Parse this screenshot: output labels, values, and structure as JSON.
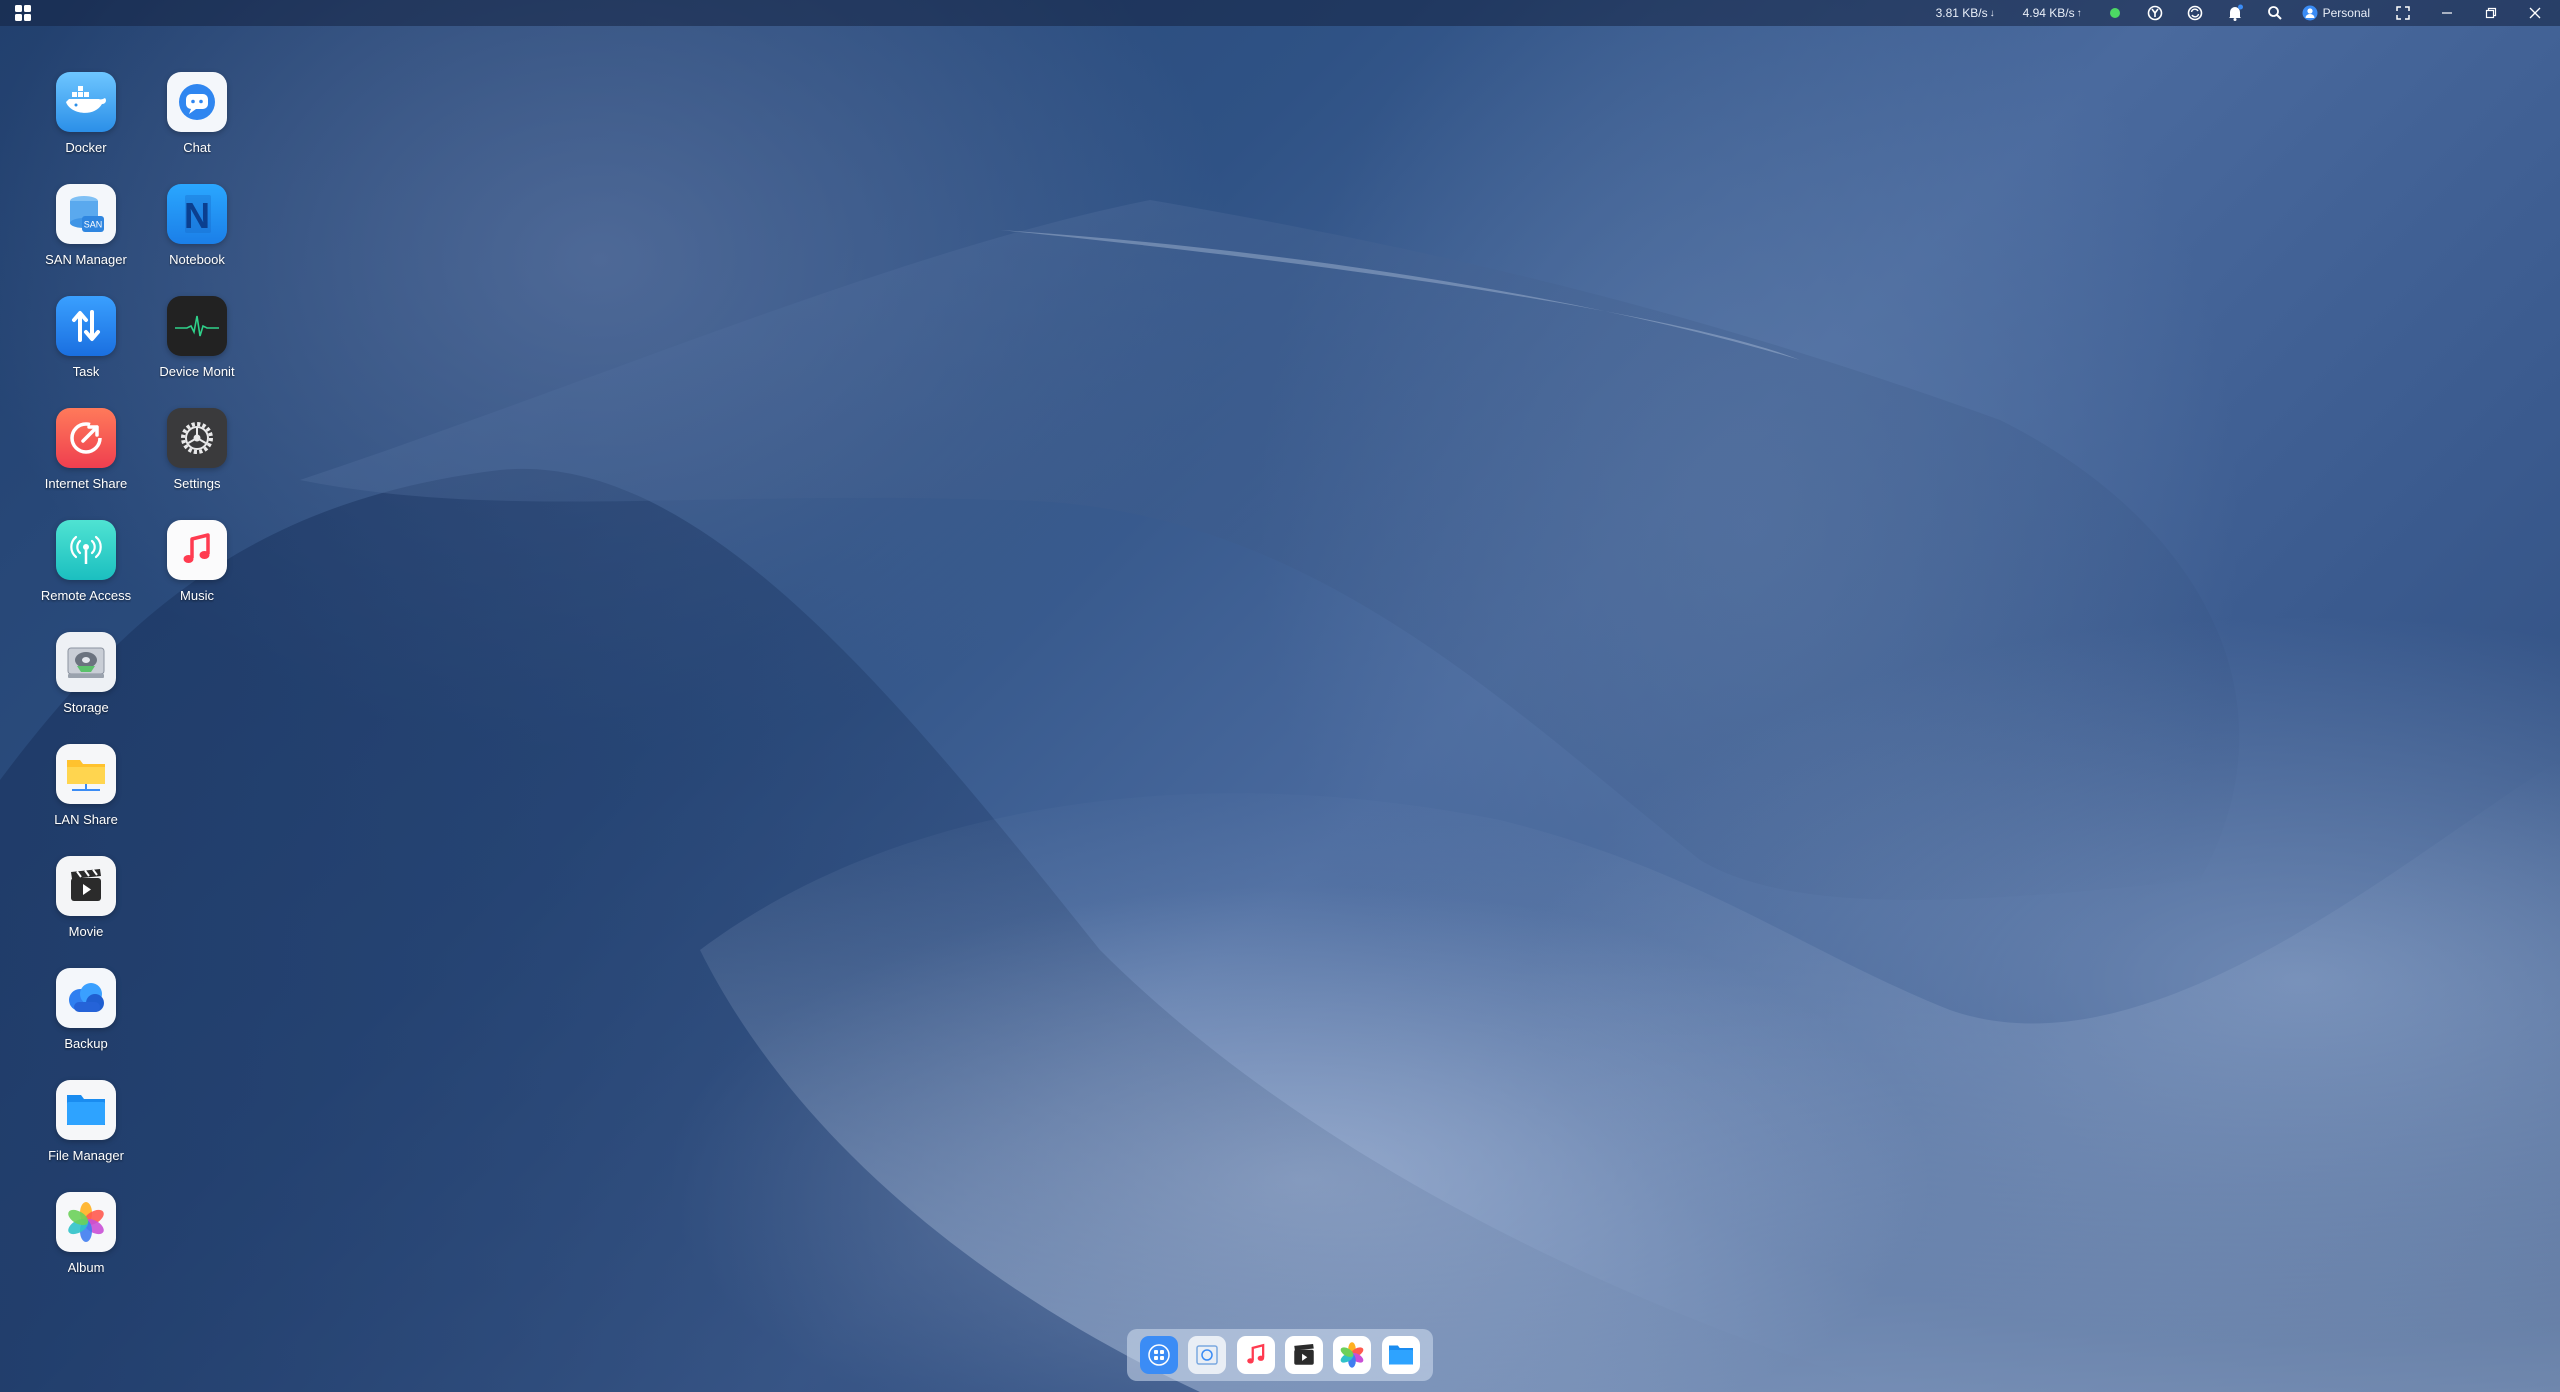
{
  "topbar": {
    "download_speed": "3.81 KB/s",
    "upload_speed": "4.94 KB/s",
    "user_label": "Personal",
    "status_color": "#4cd964",
    "icons": [
      "apps-grid-icon",
      "status-dot-icon",
      "service-icon",
      "sync-icon",
      "bell-icon",
      "search-icon",
      "user-icon",
      "fullscreen-icon",
      "minimize-icon",
      "restore-icon",
      "close-icon"
    ]
  },
  "apps": [
    {
      "label": "Docker",
      "icon": "docker-icon"
    },
    {
      "label": "Chat",
      "icon": "chat-icon"
    },
    {
      "label": "SAN Manager",
      "icon": "san-manager-icon",
      "badge": "SAN"
    },
    {
      "label": "Notebook",
      "icon": "notebook-icon",
      "glyph": "N"
    },
    {
      "label": "Task",
      "icon": "task-icon"
    },
    {
      "label": "Device Monit",
      "icon": "device-monitor-icon"
    },
    {
      "label": "Internet Share",
      "icon": "internet-share-icon"
    },
    {
      "label": "Settings",
      "icon": "settings-icon"
    },
    {
      "label": "Remote Access",
      "icon": "remote-access-icon"
    },
    {
      "label": "Music",
      "icon": "music-icon"
    },
    {
      "label": "Storage",
      "icon": "storage-icon"
    },
    {
      "label": "LAN Share",
      "icon": "lan-share-icon"
    },
    {
      "label": "Movie",
      "icon": "movie-icon"
    },
    {
      "label": "Backup",
      "icon": "backup-icon"
    },
    {
      "label": "File Manager",
      "icon": "file-manager-icon"
    },
    {
      "label": "Album",
      "icon": "album-icon"
    }
  ],
  "dock": [
    "launcher-icon",
    "storage-icon",
    "music-icon",
    "movie-icon",
    "album-icon",
    "file-manager-icon"
  ]
}
